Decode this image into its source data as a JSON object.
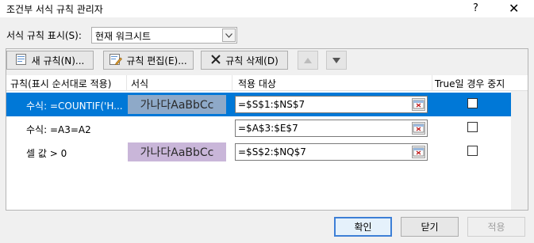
{
  "window": {
    "title": "조건부 서식 규칙 관리자",
    "help": "?",
    "close": "✕"
  },
  "scope": {
    "label": "서식 규칙 표시(S):",
    "selected": "현재 워크시트"
  },
  "toolbar": {
    "new_rule": "새 규칙(N)...",
    "edit_rule": "규칙 편집(E)...",
    "delete_rule": "규칙 삭제(D)"
  },
  "columns": {
    "rule": "규칙(표시 순서대로 적용)",
    "format": "서식",
    "applies_to": "적용 대상",
    "stop_if_true": "True일 경우 중지"
  },
  "rules": [
    {
      "condition": "수식: =COUNTIF('H...",
      "preview": "가나다AaBbCc",
      "preview_color": "#8ea9c8",
      "range": "=$S$1:$NS$7",
      "stop": false,
      "selected": true
    },
    {
      "condition": "수식: =A3=A2",
      "preview": "",
      "preview_color": "",
      "range": "=$A$3:$E$7",
      "stop": false,
      "selected": false
    },
    {
      "condition": "셀 값 > 0",
      "preview": "가나다AaBbCc",
      "preview_color": "#c9b6d9",
      "range": "=$S$2:$NQ$7",
      "stop": false,
      "selected": false
    }
  ],
  "buttons": {
    "ok": "확인",
    "close": "닫기",
    "apply": "적용"
  },
  "colors": {
    "selection": "#0078d7",
    "accent_border": "#3d7fd6"
  }
}
